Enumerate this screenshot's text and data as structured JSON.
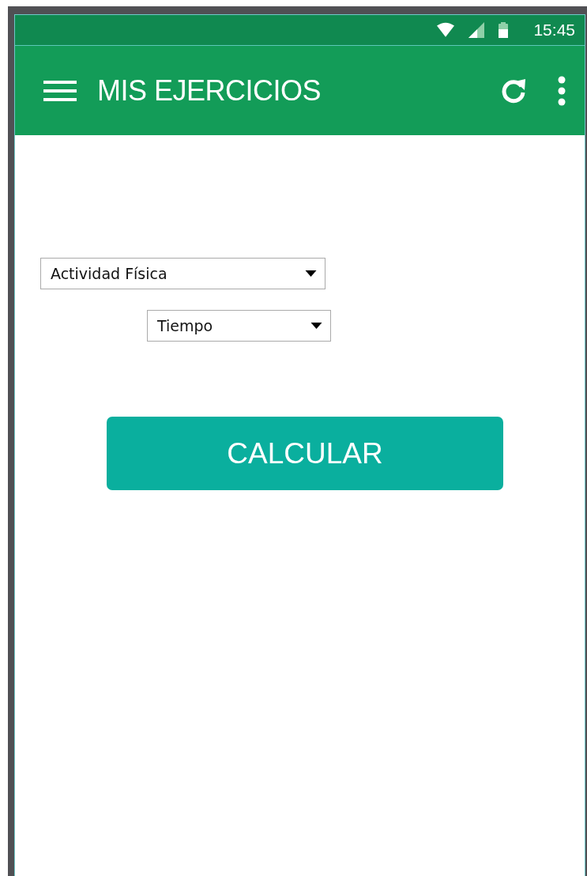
{
  "status_bar": {
    "time": "15:45"
  },
  "app_bar": {
    "title": "MIS EJERCICIOS"
  },
  "dropdowns": [
    {
      "value": "Actividad Física"
    },
    {
      "value": "Tiempo"
    }
  ],
  "button": {
    "label": "CALCULAR"
  }
}
